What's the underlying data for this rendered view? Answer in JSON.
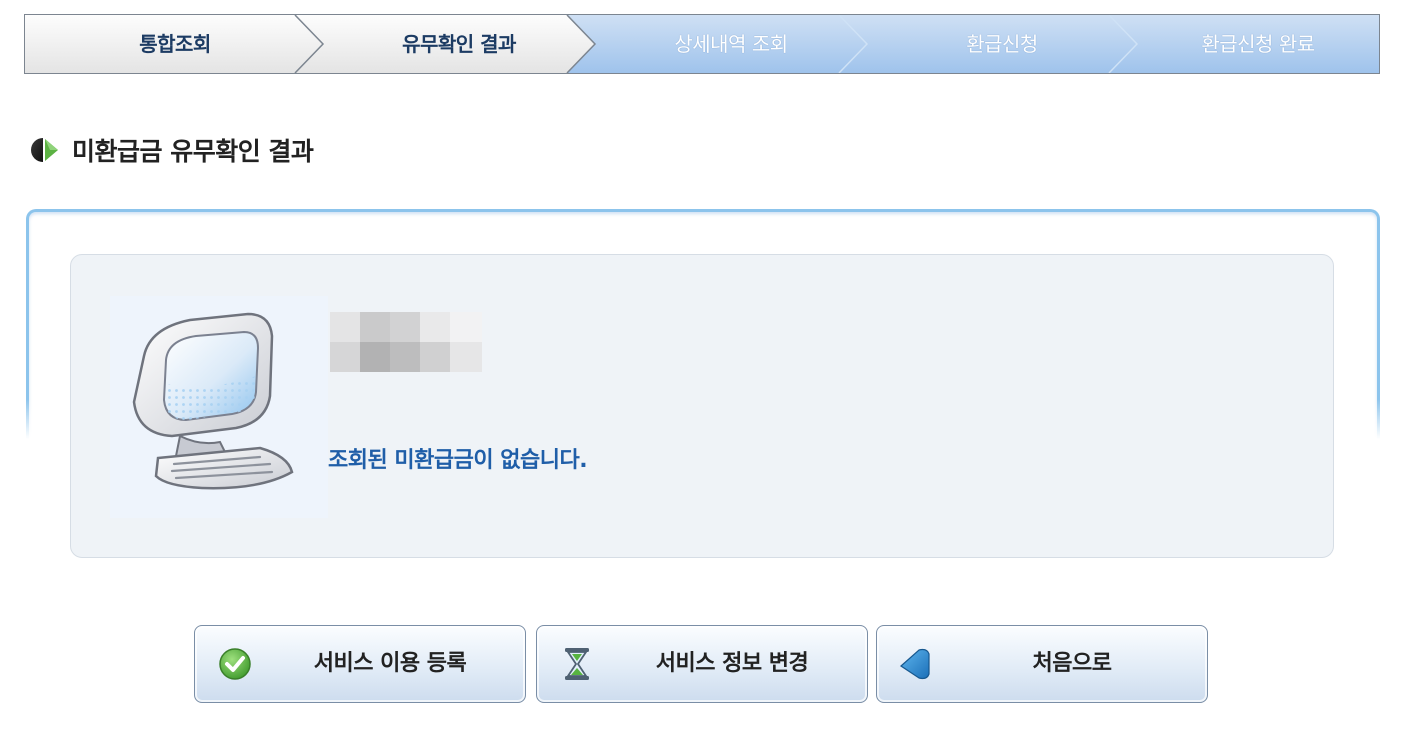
{
  "steps": [
    {
      "label": "통합조회",
      "state": "done"
    },
    {
      "label": "유무확인 결과",
      "state": "current"
    },
    {
      "label": "상세내역 조회",
      "state": "pending"
    },
    {
      "label": "환급신청",
      "state": "pending"
    },
    {
      "label": "환급신청 완료",
      "state": "pending"
    }
  ],
  "section": {
    "title": "미환급금 유무확인 결과",
    "icon": "section-bullet-icon"
  },
  "result": {
    "name_redacted": true,
    "message": "조회된 미환급금이 없습니다.",
    "illustration": "computer-icon"
  },
  "buttons": {
    "register": {
      "label": "서비스 이용 등록",
      "icon": "check-circle-icon"
    },
    "change": {
      "label": "서비스 정보 변경",
      "icon": "hourglass-icon"
    },
    "home": {
      "label": "처음으로",
      "icon": "back-arrow-icon"
    }
  },
  "colors": {
    "step_active_bg": "#f3f3f3",
    "step_pending_bg": "#9fc3ec",
    "message": "#1f5ea8",
    "box_border": "#8cc4ec",
    "check_green": "#4fae3c"
  }
}
